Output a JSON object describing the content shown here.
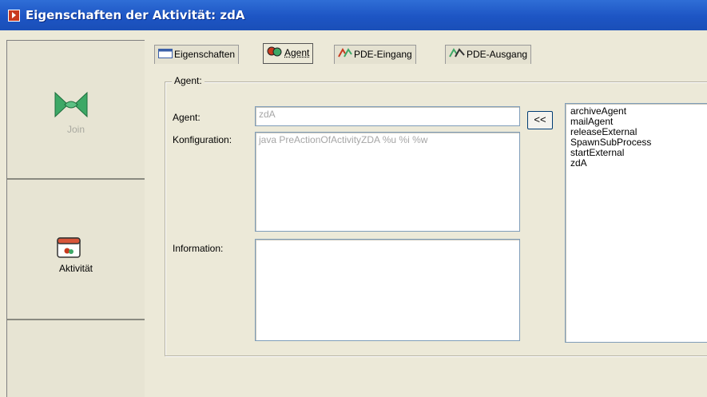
{
  "window": {
    "title": "Eigenschaften der Aktivität: zdA"
  },
  "left_panel": {
    "join_label": "Join",
    "activity_label": "Aktivität"
  },
  "tabs": [
    {
      "label": "Eigenschaften",
      "icon": "properties-icon"
    },
    {
      "label": "Agent",
      "icon": "agent-icon",
      "active": true
    },
    {
      "label": "PDE-Eingang",
      "icon": "pde-input-icon"
    },
    {
      "label": "PDE-Ausgang",
      "icon": "pde-output-icon"
    }
  ],
  "agent_group": {
    "legend": "Agent:",
    "agent_label": "Agent:",
    "agent_value": "zdA",
    "config_label": "Konfiguration:",
    "config_value": "java PreActionOfActivityZDA %u %i %w",
    "info_label": "Information:",
    "info_value": "",
    "move_button": "<<",
    "agent_list": [
      "archiveAgent",
      "mailAgent",
      "releaseExternal",
      "SpawnSubProcess",
      "startExternal",
      "zdA"
    ]
  }
}
